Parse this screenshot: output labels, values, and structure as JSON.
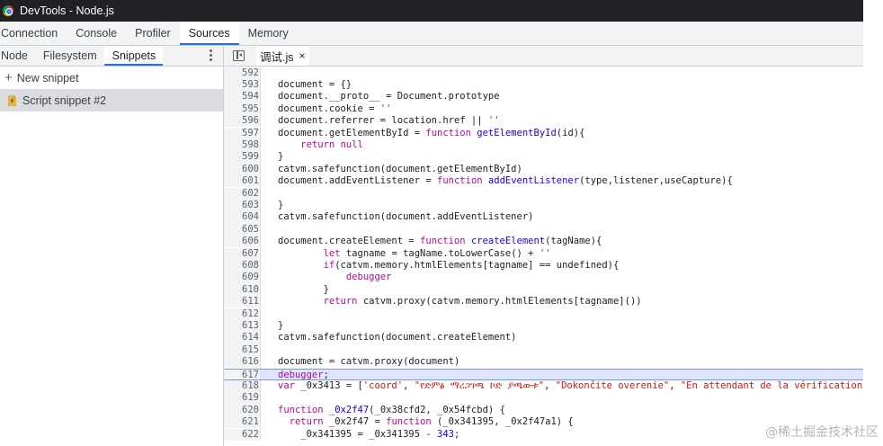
{
  "window": {
    "title": "DevTools - Node.js"
  },
  "main_tabs": [
    {
      "label": "Connection",
      "active": false
    },
    {
      "label": "Console",
      "active": false
    },
    {
      "label": "Profiler",
      "active": false
    },
    {
      "label": "Sources",
      "active": true
    },
    {
      "label": "Memory",
      "active": false
    }
  ],
  "navigator": {
    "tabs": [
      {
        "label": "Node",
        "active": false
      },
      {
        "label": "Filesystem",
        "active": false
      },
      {
        "label": "Snippets",
        "active": true
      }
    ],
    "new_snippet_label": "New snippet",
    "snippets": [
      {
        "label": "Script snippet #2",
        "selected": true
      }
    ]
  },
  "editor": {
    "file_tab": {
      "label": "调试.js",
      "close_glyph": "×"
    },
    "lines": [
      {
        "n": "592",
        "t": []
      },
      {
        "n": "593",
        "t": [
          [
            "p",
            "document = {}"
          ]
        ]
      },
      {
        "n": "594",
        "t": [
          [
            "p",
            "document.__proto__ = Document.prototype"
          ]
        ]
      },
      {
        "n": "595",
        "t": [
          [
            "p",
            "document.cookie = "
          ],
          [
            "s",
            "''"
          ]
        ]
      },
      {
        "n": "596",
        "t": [
          [
            "p",
            "document.referrer = location.href || "
          ],
          [
            "s",
            "''"
          ]
        ]
      },
      {
        "n": "597",
        "t": [
          [
            "p",
            "document.getElementById = "
          ],
          [
            "k",
            "function"
          ],
          [
            "p",
            " "
          ],
          [
            "f",
            "getElementById"
          ],
          [
            "p",
            "(id){"
          ]
        ]
      },
      {
        "n": "598",
        "t": [
          [
            "p",
            "    "
          ],
          [
            "k",
            "return"
          ],
          [
            "p",
            " "
          ],
          [
            "k",
            "null"
          ]
        ]
      },
      {
        "n": "599",
        "t": [
          [
            "p",
            "}"
          ]
        ]
      },
      {
        "n": "600",
        "t": [
          [
            "p",
            "catvm.safefunction(document.getElementById)"
          ]
        ]
      },
      {
        "n": "601",
        "t": [
          [
            "p",
            "document.addEventListener = "
          ],
          [
            "k",
            "function"
          ],
          [
            "p",
            " "
          ],
          [
            "f",
            "addEventListener"
          ],
          [
            "p",
            "(type,listener,useCapture){"
          ]
        ]
      },
      {
        "n": "602",
        "t": []
      },
      {
        "n": "603",
        "t": [
          [
            "p",
            "}"
          ]
        ]
      },
      {
        "n": "604",
        "t": [
          [
            "p",
            "catvm.safefunction(document.addEventListener)"
          ]
        ]
      },
      {
        "n": "605",
        "t": []
      },
      {
        "n": "606",
        "t": [
          [
            "p",
            "document.createElement = "
          ],
          [
            "k",
            "function"
          ],
          [
            "p",
            " "
          ],
          [
            "f",
            "createElement"
          ],
          [
            "p",
            "(tagName){"
          ]
        ]
      },
      {
        "n": "607",
        "t": [
          [
            "p",
            "        "
          ],
          [
            "k",
            "let"
          ],
          [
            "p",
            " tagname = tagName.toLowerCase() + "
          ],
          [
            "s",
            "''"
          ]
        ]
      },
      {
        "n": "608",
        "t": [
          [
            "p",
            "        "
          ],
          [
            "k",
            "if"
          ],
          [
            "p",
            "(catvm.memory.htmlElements[tagname] == undefined){"
          ]
        ]
      },
      {
        "n": "609",
        "t": [
          [
            "p",
            "            "
          ],
          [
            "k",
            "debugger"
          ]
        ]
      },
      {
        "n": "610",
        "t": [
          [
            "p",
            "        }"
          ]
        ]
      },
      {
        "n": "611",
        "t": [
          [
            "p",
            "        "
          ],
          [
            "k",
            "return"
          ],
          [
            "p",
            " catvm.proxy(catvm.memory.htmlElements[tagname]())"
          ]
        ]
      },
      {
        "n": "612",
        "t": []
      },
      {
        "n": "613",
        "t": [
          [
            "p",
            "}"
          ]
        ]
      },
      {
        "n": "614",
        "t": [
          [
            "p",
            "catvm.safefunction(document.createElement)"
          ]
        ]
      },
      {
        "n": "615",
        "t": []
      },
      {
        "n": "616",
        "t": [
          [
            "p",
            "document = catvm.proxy(document)"
          ]
        ]
      },
      {
        "n": "617",
        "t": [
          [
            "k",
            "debugger"
          ],
          [
            "p",
            ";"
          ]
        ],
        "current": true
      },
      {
        "n": "618",
        "t": [
          [
            "k",
            "var"
          ],
          [
            "p",
            " _0x3413 = ["
          ],
          [
            "s",
            "'coord'"
          ],
          [
            "p",
            ", "
          ],
          [
            "s",
            "\"የድምፅ ማረጋገጫ ኮድ ያጫውቱ\""
          ],
          [
            "p",
            ", "
          ],
          [
            "s",
            "\"Dokončite overenie\""
          ],
          [
            "p",
            ", "
          ],
          [
            "s",
            "\"En attendant de la vérification"
          ]
        ]
      },
      {
        "n": "619",
        "t": []
      },
      {
        "n": "620",
        "t": [
          [
            "k",
            "function"
          ],
          [
            "p",
            " "
          ],
          [
            "f",
            "_0x2f47"
          ],
          [
            "p",
            "(_0x38cfd2, _0x54fcbd) {"
          ]
        ]
      },
      {
        "n": "621",
        "t": [
          [
            "p",
            "  "
          ],
          [
            "k",
            "return"
          ],
          [
            "p",
            " _0x2f47 = "
          ],
          [
            "k",
            "function"
          ],
          [
            "p",
            " (_0x341395, _0x2f47a1) {"
          ]
        ]
      },
      {
        "n": "622",
        "t": [
          [
            "p",
            "    _0x341395 = _0x341395 - "
          ],
          [
            "n",
            "343"
          ],
          [
            "p",
            ";"
          ]
        ]
      }
    ]
  },
  "watermark": "@稀土掘金技术社区",
  "colors": {
    "accent": "#1a73e8",
    "keyword": "#aa0d91",
    "function_name": "#1c00cf",
    "string": "#c41a16",
    "current_line": "#dde6fb"
  }
}
